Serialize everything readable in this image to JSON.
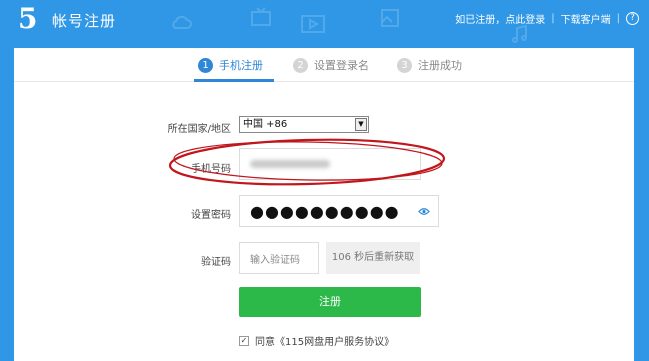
{
  "header": {
    "logo": "5",
    "title": "帐号注册",
    "links": [
      {
        "label": "如已注册，点此登录"
      },
      {
        "label": "下载客户端"
      }
    ],
    "help": "?"
  },
  "steps": [
    {
      "num": "1",
      "label": "手机注册"
    },
    {
      "num": "2",
      "label": "设置登录名"
    },
    {
      "num": "3",
      "label": "注册成功"
    }
  ],
  "form": {
    "country_label": "所在国家/地区",
    "country_value": "中国 +86",
    "phone_label": "手机号码",
    "password_label": "设置密码",
    "password_value": "●●●●●●●●●●",
    "code_label": "验证码",
    "code_placeholder": "输入验证码",
    "resend": "106 秒后重新获取",
    "submit": "注册",
    "agree_text": "同意《115网盘用户服务协议》"
  },
  "colors": {
    "accent": "#2f87d7",
    "submit": "#2cb94a",
    "annotation": "#c0161c"
  }
}
